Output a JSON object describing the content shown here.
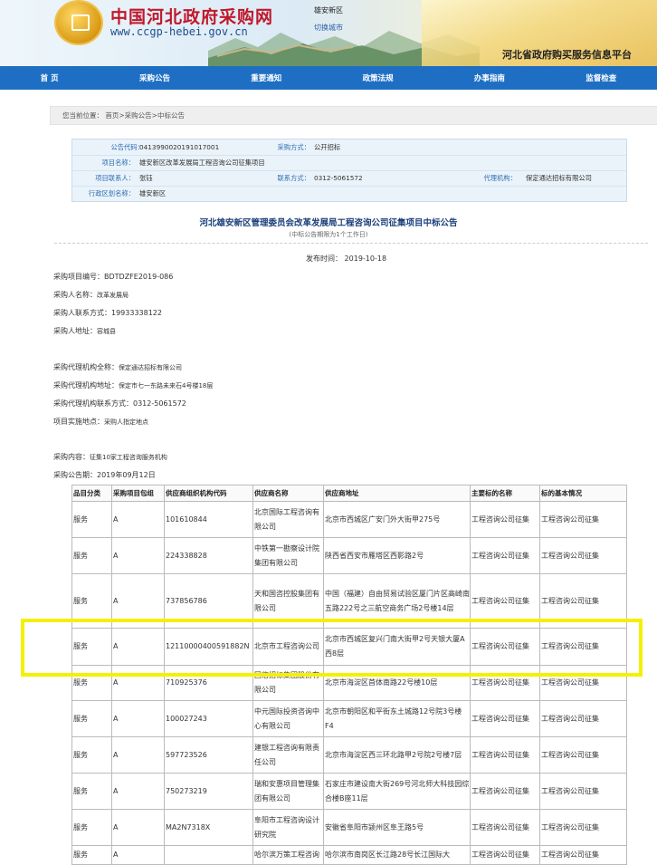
{
  "header": {
    "site_title": "中国河北政府采购网",
    "site_url": "www.ccgp-hebei.gov.cn",
    "region": "雄安新区",
    "region_link": "切换城市",
    "slogan": "河北省政府购买服务信息平台"
  },
  "nav": [
    "首 页",
    "采购公告",
    "重要通知",
    "政策法规",
    "办事指南",
    "监督检查"
  ],
  "breadcrumb": {
    "prefix": "您当前位置：",
    "path": "首页>采购公告>中标公告"
  },
  "info": {
    "code_label": "公告代码：",
    "code_value": "0413990020191017001",
    "method_label": "采购方式：",
    "method_value": "公开招标",
    "project_label": "项目名称：",
    "project_value": "雄安新区改革发展局工程咨询公司征集项目",
    "contact_label": "项目联系人：",
    "contact_value": "张钰",
    "phone_label": "联系方式：",
    "phone_value": "0312-5061572",
    "agency_label": "代理机构：",
    "agency_value": "保定通达招标有限公司",
    "district_label": "行政区划名称：",
    "district_value": "雄安新区"
  },
  "notice": {
    "title": "河北雄安新区管理委员会改革发展局工程咨询公司征集项目中标公告",
    "subtitle": "(中标公告期限为1个工作日)",
    "publish_label": "发布时间：",
    "publish_date": "2019-10-18",
    "project_no_label": "采购项目编号：",
    "project_no": "BDTDZFE2019-086",
    "buyer_label": "采购人名称：",
    "buyer": "改革发展局",
    "buyer_contact_label": "采购人联系方式：",
    "buyer_contact": "19933338122",
    "buyer_addr_label": "采购人地址：",
    "buyer_addr": "容城县",
    "agent_name_label": "采购代理机构全称：",
    "agent_name": "保定通达招标有限公司",
    "agent_addr_label": "采购代理机构地址：",
    "agent_addr": "保定市七一东路未来石4号楼18层",
    "agent_phone_label": "采购代理机构联系方式：",
    "agent_phone": "0312-5061572",
    "site_label": "项目实施地点：",
    "site": "采购人指定地点",
    "content_label": "采购内容：",
    "content": "征集10家工程咨询服务机构",
    "notice_date_label": "采购公告期：",
    "notice_date": "2019年09月12日"
  },
  "table": {
    "headers": [
      "品目分类",
      "采购项目包组",
      "供应商组织机构代码",
      "供应商名称",
      "供应商地址",
      "主要标的名称",
      "标的基本情况"
    ],
    "rows": [
      [
        "服务",
        "A",
        "101610844",
        "北京国际工程咨询有限公司",
        "北京市西城区广安门外大街甲275号",
        "工程咨询公司征集",
        "工程咨询公司征集"
      ],
      [
        "服务",
        "A",
        "224338828",
        "中铁第一勘察设计院集团有限公司",
        "陕西省西安市雁塔区西影路2号",
        "工程咨询公司征集",
        "工程咨询公司征集"
      ],
      [
        "服务",
        "A",
        "737856786",
        "天和国咨控股集团有限公司",
        "中国（福建）自由贸易试验区厦门片区高崎南五路222号之三航空商务广场2号楼14层",
        "工程咨询公司征集",
        "工程咨询公司征集"
      ],
      [
        "服务",
        "A",
        "12110000400591882N",
        "北京市工程咨询公司",
        "北京市西城区复兴门南大街甲2号天银大厦A西8层",
        "工程咨询公司征集",
        "工程咨询公司征集"
      ],
      [
        "服务",
        "A",
        "710925376",
        "国信招标集团股份有限公司",
        "北京市海淀区首体南路22号楼10层",
        "工程咨询公司征集",
        "工程咨询公司征集"
      ],
      [
        "服务",
        "A",
        "100027243",
        "中元国际投资咨询中心有限公司",
        "北京市朝阳区和平街东土城路12号院3号楼F4",
        "工程咨询公司征集",
        "工程咨询公司征集"
      ],
      [
        "服务",
        "A",
        "597723526",
        "建银工程咨询有限责任公司",
        "北京市海淀区西三环北路甲2号院2号楼7层",
        "工程咨询公司征集",
        "工程咨询公司征集"
      ],
      [
        "服务",
        "A",
        "750273219",
        "瑞和安惠项目管理集团有限公司",
        "石家庄市建设南大街269号河北师大科技园综合楼B座11层",
        "工程咨询公司征集",
        "工程咨询公司征集"
      ],
      [
        "服务",
        "A",
        "MA2N7318X",
        "阜阳市工程咨询设计研究院",
        "安徽省阜阳市颍州区阜王路5号",
        "工程咨询公司征集",
        "工程咨询公司征集"
      ],
      [
        "服务",
        "A",
        "",
        "哈尔滨万策工程咨询",
        "哈尔滨市南岗区长江路28号长江国际大",
        "工程咨询公司征集",
        "工程咨询公司征集"
      ]
    ]
  }
}
